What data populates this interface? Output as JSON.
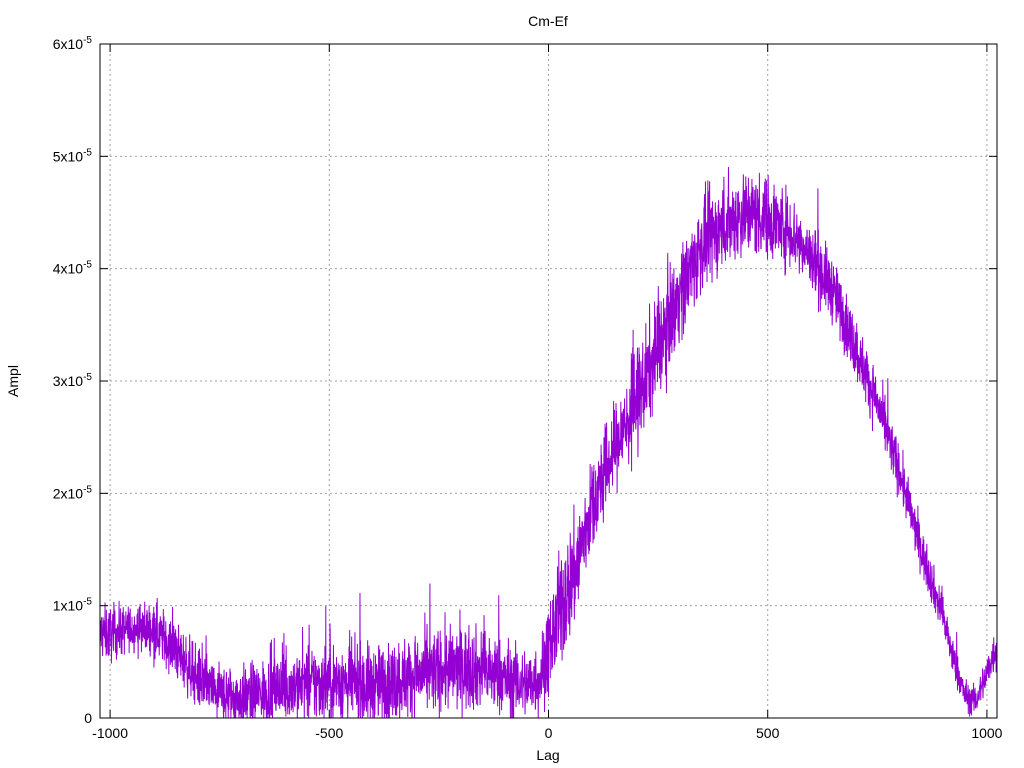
{
  "chart_data": {
    "type": "line",
    "title": "Cm-Ef",
    "xlabel": "Lag",
    "ylabel": "Ampl",
    "xlim": [
      -1023,
      1023
    ],
    "ylim": [
      0,
      6e-05
    ],
    "grid": true,
    "legend": "none",
    "x_ticks": [
      {
        "value": -1000,
        "label": "-1000"
      },
      {
        "value": -500,
        "label": "-500"
      },
      {
        "value": 0,
        "label": "0"
      },
      {
        "value": 500,
        "label": "500"
      },
      {
        "value": 1000,
        "label": "1000"
      }
    ],
    "y_ticks": [
      {
        "value": 0,
        "label": "0"
      },
      {
        "value": 1e-05,
        "mantissa": "1x10",
        "exponent": "-5"
      },
      {
        "value": 2e-05,
        "mantissa": "2x10",
        "exponent": "-5"
      },
      {
        "value": 3e-05,
        "mantissa": "3x10",
        "exponent": "-5"
      },
      {
        "value": 4e-05,
        "mantissa": "4x10",
        "exponent": "-5"
      },
      {
        "value": 5e-05,
        "mantissa": "5x10",
        "exponent": "-5"
      },
      {
        "value": 6e-05,
        "mantissa": "6x10",
        "exponent": "-5"
      }
    ],
    "series": [
      {
        "color": "#9400d3",
        "x": [
          -1023,
          -1000,
          -950,
          -900,
          -850,
          -800,
          -750,
          -700,
          -650,
          -600,
          -550,
          -500,
          -450,
          -400,
          -350,
          -300,
          -250,
          -200,
          -150,
          -100,
          -50,
          -20,
          0,
          30,
          60,
          100,
          150,
          200,
          250,
          300,
          350,
          400,
          450,
          500,
          550,
          600,
          650,
          700,
          750,
          800,
          850,
          900,
          925,
          950,
          975,
          1000,
          1023
        ],
        "y": [
          7.5e-06,
          7.5e-06,
          8e-06,
          8e-06,
          6e-06,
          3.5e-06,
          2e-06,
          1.8e-06,
          2.2e-06,
          2.8e-06,
          3e-06,
          3.2e-06,
          3e-06,
          2.8e-06,
          3.3e-06,
          3.8e-06,
          4.2e-06,
          4.5e-06,
          4.3e-06,
          3.5e-06,
          3e-06,
          3.5e-06,
          6e-06,
          1e-05,
          1.3e-05,
          1.9e-05,
          2.4e-05,
          2.8e-05,
          3.3e-05,
          3.8e-05,
          4.2e-05,
          4.4e-05,
          4.5e-05,
          4.45e-05,
          4.35e-05,
          4.1e-05,
          3.8e-05,
          3.3e-05,
          2.8e-05,
          2.2e-05,
          1.5e-05,
          9e-06,
          5e-06,
          2e-06,
          1.5e-06,
          4e-06,
          6.5e-06
        ],
        "noise_amplitude": [
          2.2e-06,
          2.2e-06,
          1.8e-06,
          2.2e-06,
          2.2e-06,
          2.4e-06,
          2.4e-06,
          2.4e-06,
          2.6e-06,
          2.8e-06,
          3e-06,
          3.2e-06,
          3.2e-06,
          3.2e-06,
          3.2e-06,
          3.2e-06,
          3.3e-06,
          3.3e-06,
          3.2e-06,
          3e-06,
          2.8e-06,
          3e-06,
          3.5e-06,
          4.5e-06,
          4.5e-06,
          3.5e-06,
          3.5e-06,
          4e-06,
          4e-06,
          3.8e-06,
          3.6e-06,
          3.5e-06,
          3.4e-06,
          3.3e-06,
          3e-06,
          2.8e-06,
          2.6e-06,
          2.4e-06,
          2.2e-06,
          2e-06,
          1.8e-06,
          1.6e-06,
          1.5e-06,
          1.2e-06,
          1.2e-06,
          1.5e-06,
          1.8e-06
        ]
      }
    ]
  }
}
